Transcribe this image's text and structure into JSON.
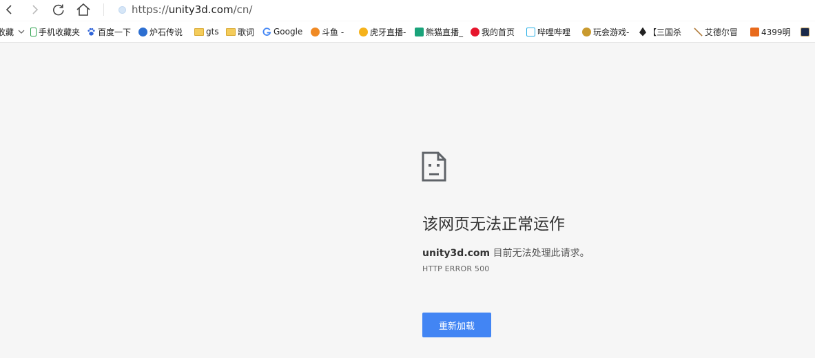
{
  "toolbar": {
    "url_scheme": "https://",
    "url_host": "unity3d.com",
    "url_path": "/cn/"
  },
  "bookmarks": [
    {
      "label": "收藏",
      "icon": "dropdown-icon"
    },
    {
      "label": "手机收藏夹",
      "icon": "phone-icon"
    },
    {
      "label": "百度一下",
      "icon": "baidu-paw-icon"
    },
    {
      "label": "炉石传说",
      "icon": "yy-icon"
    },
    {
      "label": "gts",
      "icon": "folder-icon"
    },
    {
      "label": "歌词",
      "icon": "folder-icon"
    },
    {
      "label": "Google",
      "icon": "google-g-icon"
    },
    {
      "label": "斗鱼 -",
      "icon": "douyu-icon"
    },
    {
      "label": "虎牙直播-",
      "icon": "huya-icon"
    },
    {
      "label": "熊猫直播_",
      "icon": "panda-icon"
    },
    {
      "label": "我的首页",
      "icon": "weibo-icon"
    },
    {
      "label": "哔哩哔哩",
      "icon": "bilibili-icon"
    },
    {
      "label": "玩会游戏-",
      "icon": "game-icon"
    },
    {
      "label": "【三国杀",
      "icon": "sanguosha-icon"
    },
    {
      "label": "艾德尔冒",
      "icon": "sword-icon"
    },
    {
      "label": "4399明",
      "icon": "4399-icon"
    },
    {
      "label": "",
      "icon": "lol-icon"
    }
  ],
  "error": {
    "title": "该网页无法正常运作",
    "host": "unity3d.com",
    "message": " 目前无法处理此请求。",
    "code": "HTTP ERROR 500",
    "reload_label": "重新加载"
  },
  "colors": {
    "reload_button": "#4285f4",
    "page_background": "#f6f6f6"
  }
}
